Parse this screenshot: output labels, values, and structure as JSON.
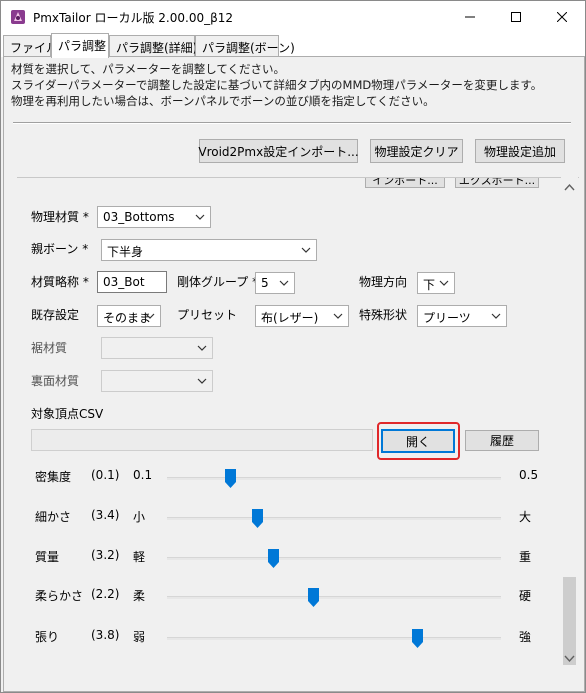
{
  "window": {
    "title": "PmxTailor ローカル版 2.00.00_β12",
    "app_icon": "pmx-tailor-app-icon",
    "controls": [
      "minimize-icon",
      "maximize-icon",
      "close-icon"
    ]
  },
  "tabs": [
    {
      "label": "ファイル",
      "active": false
    },
    {
      "label": "パラ調整",
      "active": true
    },
    {
      "label": "パラ調整(詳細)",
      "active": false
    },
    {
      "label": "パラ調整(ボーン)",
      "active": false
    }
  ],
  "description": [
    "材質を選択して、パラメーターを調整してください。",
    "スライダーパラメーターで調整した設定に基づいて詳細タブ内のMMD物理パラメーターを変更します。",
    "物理を再利用したい場合は、ボーンパネルでボーンの並び順を指定してください。"
  ],
  "toolbar": {
    "import_label": "Vroid2Pmx設定インポート...",
    "clear_label": "物理設定クリア",
    "add_label": "物理設定追加"
  },
  "partial": {
    "import_label": "インポート...",
    "export_label": "エクスポート..."
  },
  "form": {
    "material_label": "物理材質 *",
    "material_value": "03_Bottoms",
    "parent_bone_label": "親ボーン *",
    "parent_bone_value": "下半身",
    "abbrev_label": "材質略称 *",
    "abbrev_value": "03_Bot",
    "rigid_group_label": "剛体グループ *",
    "rigid_group_value": "5",
    "direction_label": "物理方向",
    "direction_value": "下",
    "preset_existing_label": "既存設定",
    "preset_existing_value": "そのまま",
    "preset_label": "プリセット",
    "preset_value": "布(レザー)",
    "special_shape_label": "特殊形状",
    "special_shape_value": "プリーツ",
    "hem_material_label": "裾材質",
    "hem_material_value": "",
    "back_material_label": "裏面材質",
    "back_material_value": "",
    "csv_label": "対象頂点CSV",
    "csv_path": "",
    "open_label": "開く",
    "history_label": "履歴"
  },
  "sliders": [
    {
      "name": "密集度",
      "value": "(0.1)",
      "min_label": "0.1",
      "max_label": "0.5",
      "fraction": 0.19
    },
    {
      "name": "細かさ",
      "value": "(3.4)",
      "min_label": "小",
      "max_label": "大",
      "fraction": 0.27
    },
    {
      "name": "質量",
      "value": "(3.2)",
      "min_label": "軽",
      "max_label": "重",
      "fraction": 0.32
    },
    {
      "name": "柔らかさ",
      "value": "(2.2)",
      "min_label": "柔",
      "max_label": "硬",
      "fraction": 0.44
    },
    {
      "name": "張り",
      "value": "(3.8)",
      "min_label": "弱",
      "max_label": "強",
      "fraction": 0.75
    }
  ],
  "colors": {
    "accent": "#0078d7",
    "highlight": "#e0282a",
    "window_bg": "#f0f0f0"
  }
}
